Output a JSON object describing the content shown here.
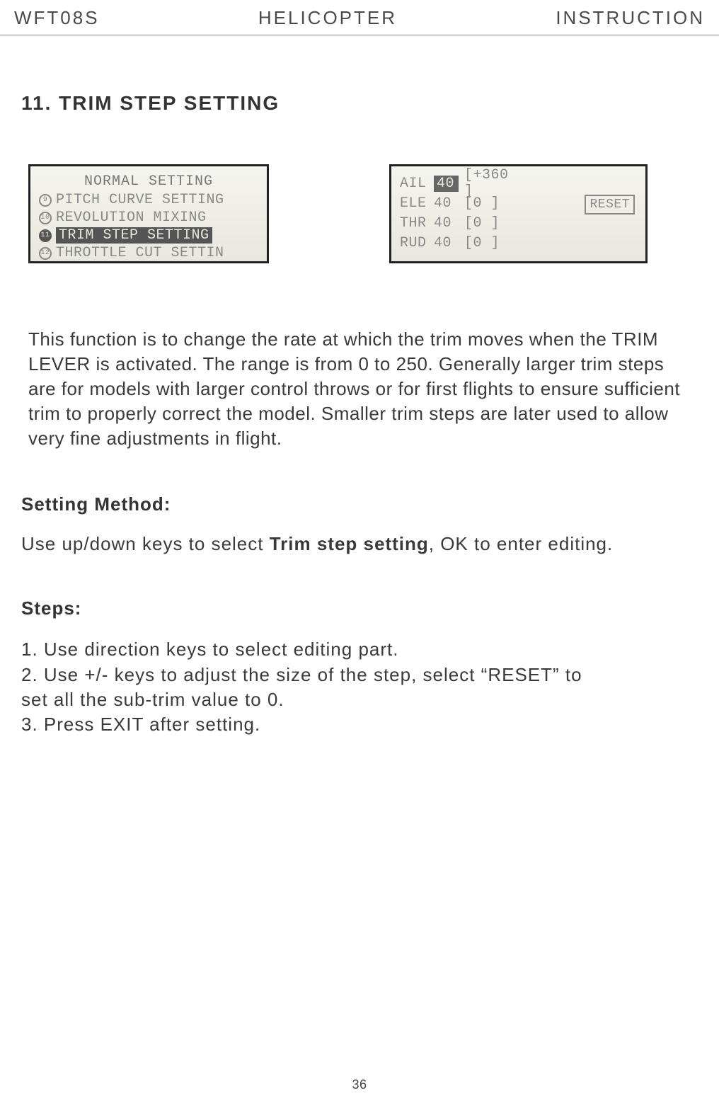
{
  "header": {
    "left": "WFT08S",
    "center": "HELICOPTER",
    "right": "INSTRUCTION"
  },
  "section_title": "11. TRIM STEP SETTING",
  "lcd1": {
    "title": "NORMAL SETTING",
    "items": [
      {
        "num": "9",
        "label": "PITCH CURVE SETTING",
        "selected": false
      },
      {
        "num": "10",
        "label": "REVOLUTION MIXING",
        "selected": false
      },
      {
        "num": "11",
        "label": "TRIM STEP SETTING",
        "selected": true
      },
      {
        "num": "12",
        "label": "THROTTLE CUT SETTIN",
        "selected": false
      }
    ]
  },
  "lcd2": {
    "rows": [
      {
        "label": "AIL",
        "val": "40",
        "bracket": "[+360 ]",
        "selected": true
      },
      {
        "label": "ELE",
        "val": "40",
        "bracket": "[0    ]",
        "selected": false
      },
      {
        "label": "THR",
        "val": "40",
        "bracket": "[0    ]",
        "selected": false
      },
      {
        "label": "RUD",
        "val": "40",
        "bracket": "[0    ]",
        "selected": false
      }
    ],
    "reset": "RESET"
  },
  "description": "This function is to change the rate at which the trim moves when the TRIM LEVER is activated.  The range is from 0 to 250. Generally larger trim steps are for models with larger control throws or for first flights to ensure sufficient trim to properly correct the model. Smaller trim steps are later used to allow very fine adjustments in flight.",
  "setting_method": {
    "heading": "Setting Method:",
    "text_before": "Use up/down keys to select ",
    "text_bold": "Trim step setting",
    "text_after": ", OK to enter editing."
  },
  "steps": {
    "heading": "Steps:",
    "items": [
      "1. Use direction keys to select editing part.",
      "2. Use +/- keys to adjust the size of the step, select “RESET” to",
      "    set all the sub-trim value to 0.",
      "3. Press EXIT after setting."
    ]
  },
  "page_number": "36"
}
